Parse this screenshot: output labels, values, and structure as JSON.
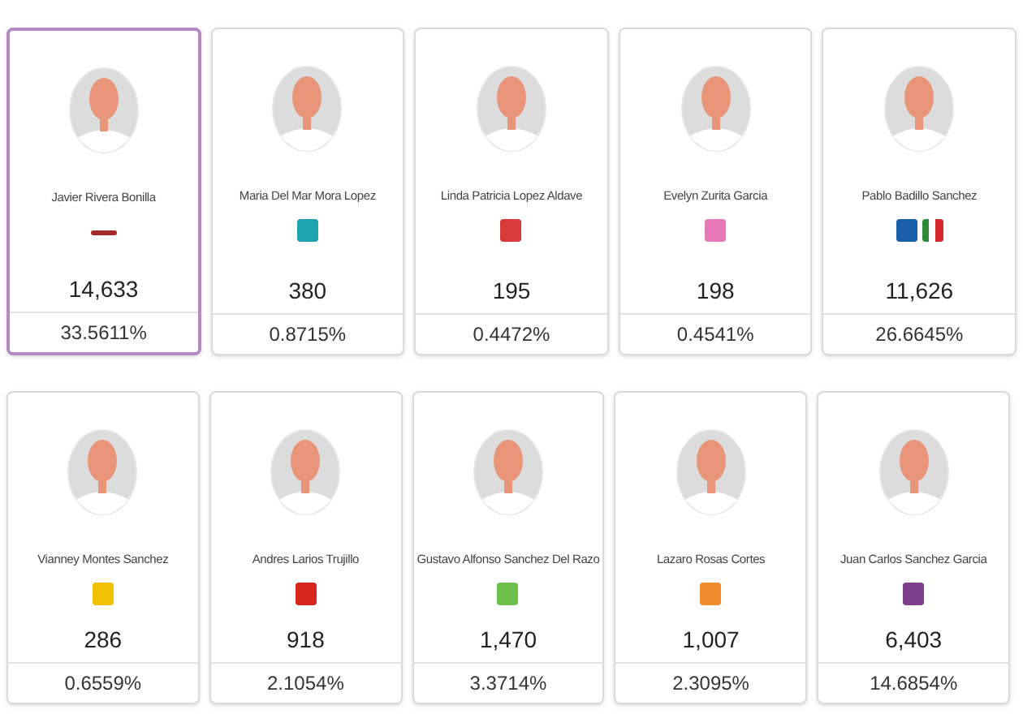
{
  "rows": [
    {
      "candidates": [
        {
          "name": "Javier Rivera Bonilla",
          "selected": true,
          "logos": [
            {
              "kind": "wordmark",
              "color": "#a52a2a"
            }
          ],
          "votes": "14,633",
          "percent": "33.5611%"
        },
        {
          "name": "Maria Del Mar Mora Lopez",
          "selected": false,
          "logos": [
            {
              "kind": "emblem",
              "color": "#1fa3b0"
            }
          ],
          "votes": "380",
          "percent": "0.8715%"
        },
        {
          "name": "Linda Patricia Lopez Aldave",
          "selected": false,
          "logos": [
            {
              "kind": "emblem",
              "color": "#d83a3a"
            }
          ],
          "votes": "195",
          "percent": "0.4472%"
        },
        {
          "name": "Evelyn Zurita Garcia",
          "selected": false,
          "logos": [
            {
              "kind": "emblem",
              "color": "#e879b9"
            }
          ],
          "votes": "198",
          "percent": "0.4541%"
        },
        {
          "name": "Pablo Badillo Sanchez",
          "selected": false,
          "logos": [
            {
              "kind": "emblem",
              "color": "#1b5fa8"
            },
            {
              "kind": "tricolor",
              "color": "#2e8b3a"
            }
          ],
          "votes": "11,626",
          "percent": "26.6645%"
        }
      ]
    },
    {
      "candidates": [
        {
          "name": "Vianney Montes Sanchez",
          "selected": false,
          "logos": [
            {
              "kind": "emblem",
              "color": "#f2c200"
            }
          ],
          "votes": "286",
          "percent": "0.6559%"
        },
        {
          "name": "Andres Larios Trujillo",
          "selected": false,
          "logos": [
            {
              "kind": "emblem",
              "color": "#d8261f"
            }
          ],
          "votes": "918",
          "percent": "2.1054%"
        },
        {
          "name": "Gustavo Alfonso Sanchez Del Razo",
          "selected": false,
          "logos": [
            {
              "kind": "emblem",
              "color": "#6cc04a"
            }
          ],
          "votes": "1,470",
          "percent": "3.3714%"
        },
        {
          "name": "Lazaro Rosas Cortes",
          "selected": false,
          "logos": [
            {
              "kind": "emblem",
              "color": "#f08a2a"
            }
          ],
          "votes": "1,007",
          "percent": "2.3095%"
        },
        {
          "name": "Juan Carlos Sanchez Garcia",
          "selected": false,
          "logos": [
            {
              "kind": "emblem",
              "color": "#7b3f8c"
            }
          ],
          "votes": "6,403",
          "percent": "14.6854%"
        }
      ]
    }
  ]
}
